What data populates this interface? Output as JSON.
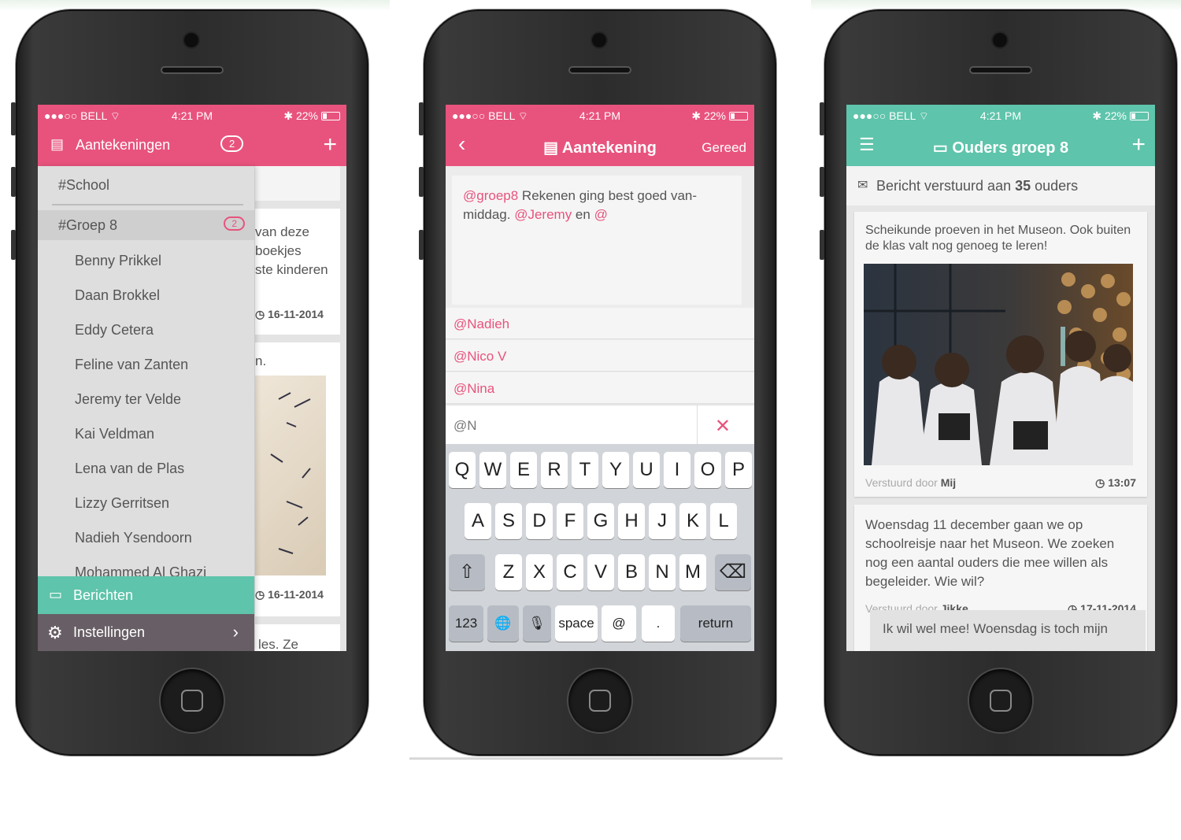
{
  "status_bar": {
    "carrier": "●●●○○ BELL ⌔",
    "time": "4:21 PM",
    "battery": "✱ 22%"
  },
  "colors": {
    "pink": "#e8537d",
    "teal": "#5ec4ab",
    "dark_gray": "#685e65"
  },
  "phone1": {
    "header": {
      "title": "Aantekeningen",
      "badge": "2",
      "add": "+"
    },
    "drawer": {
      "school": "#School",
      "group": {
        "label": "#Groep 8",
        "badge": "2"
      },
      "students": [
        "Benny Prikkel",
        "Daan Brokkel",
        "Eddy Cetera",
        "Feline van Zanten",
        "Jeremy ter Velde",
        "Kai Veldman",
        "Lena van de Plas",
        "Lizzy Gerritsen",
        "Nadieh Ysendoorn",
        "Mohammed Al Ghazi"
      ],
      "messages": "Berichten",
      "settings": "Instellingen"
    },
    "behind": {
      "line1": "van deze",
      "line2": "boekjes",
      "line3": "ste kinderen",
      "date1": "16-11-2014",
      "line4": "n.",
      "date2": "16-11-2014",
      "line5": "les. Ze"
    }
  },
  "phone2": {
    "header": {
      "title": "Aantekening",
      "done": "Gereed"
    },
    "note": {
      "mention1": "@groep8",
      "text1": " Rekenen ging best goed van-",
      "text2": "middag. ",
      "mention2": "@Jeremy",
      "text3": " en ",
      "mention3": "@"
    },
    "suggestions": [
      "@Nadieh",
      "@Nico V",
      "@Nina"
    ],
    "input_value": "@N",
    "keyboard": {
      "row1": [
        "Q",
        "W",
        "E",
        "R",
        "T",
        "Y",
        "U",
        "I",
        "O",
        "P"
      ],
      "row2": [
        "A",
        "S",
        "D",
        "F",
        "G",
        "H",
        "J",
        "K",
        "L"
      ],
      "row3": [
        "Z",
        "X",
        "C",
        "V",
        "B",
        "N",
        "M"
      ],
      "num": "123",
      "space": "space",
      "at": "@",
      "dot": ".",
      "return": "return"
    }
  },
  "phone3": {
    "header": {
      "title": "Ouders groep 8"
    },
    "sent": {
      "prefix": "Bericht verstuurd aan ",
      "count": "35",
      "suffix": " ouders"
    },
    "post1": {
      "text": "Scheikunde proeven in het Museon. Ook buiten de klas valt nog genoeg te leren!",
      "sent_by_label": "Verstuurd door",
      "sender": "Mij",
      "time": "13:07"
    },
    "post2": {
      "text": "Woensdag 11 december gaan we op schoolreisje naar het Museon. We zoeken nog een aantal ouders die mee willen als begeleider. Wie wil?",
      "sent_by_label": "Verstuurd door",
      "sender": "Jikke",
      "date": "17-11-2014"
    },
    "reply": "Ik wil wel mee! Woensdag is toch mijn"
  }
}
